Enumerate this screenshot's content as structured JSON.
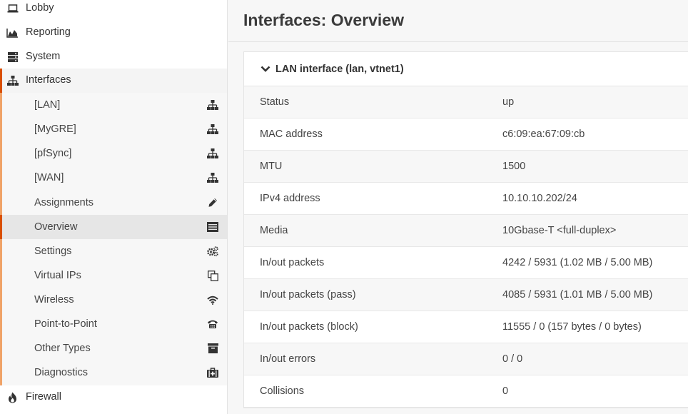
{
  "sidebar": {
    "lobby": "Lobby",
    "reporting": "Reporting",
    "system": "System",
    "interfaces": "Interfaces",
    "firewall": "Firewall",
    "sub_items": [
      {
        "label": "[LAN]",
        "icon": "network-icon"
      },
      {
        "label": "[MyGRE]",
        "icon": "network-icon"
      },
      {
        "label": "[pfSync]",
        "icon": "network-icon"
      },
      {
        "label": "[WAN]",
        "icon": "network-icon"
      },
      {
        "label": "Assignments",
        "icon": "pencil-icon"
      },
      {
        "label": "Overview",
        "icon": "list-icon"
      },
      {
        "label": "Settings",
        "icon": "cogs-icon"
      },
      {
        "label": "Virtual IPs",
        "icon": "copy-icon"
      },
      {
        "label": "Wireless",
        "icon": "wifi-icon"
      },
      {
        "label": "Point-to-Point",
        "icon": "phone-icon"
      },
      {
        "label": "Other Types",
        "icon": "archive-icon"
      },
      {
        "label": "Diagnostics",
        "icon": "medkit-icon"
      }
    ]
  },
  "main": {
    "title": "Interfaces: Overview",
    "panel": {
      "header": "LAN interface (lan, vtnet1)",
      "rows": [
        {
          "key": "Status",
          "value": "up"
        },
        {
          "key": "MAC address",
          "value": "c6:09:ea:67:09:cb"
        },
        {
          "key": "MTU",
          "value": "1500"
        },
        {
          "key": "IPv4 address",
          "value": "10.10.10.202/24"
        },
        {
          "key": "Media",
          "value": "10Gbase-T <full-duplex>"
        },
        {
          "key": "In/out packets",
          "value": "4242 / 5931 (1.02 MB / 5.00 MB)"
        },
        {
          "key": "In/out packets (pass)",
          "value": "4085 / 5931 (1.01 MB / 5.00 MB)"
        },
        {
          "key": "In/out packets (block)",
          "value": "11555 / 0 (157 bytes / 0 bytes)"
        },
        {
          "key": "In/out errors",
          "value": "0 / 0"
        },
        {
          "key": "Collisions",
          "value": "0"
        }
      ]
    }
  },
  "colors": {
    "accent": "#d94f00",
    "accent_light": "#f0a368"
  }
}
